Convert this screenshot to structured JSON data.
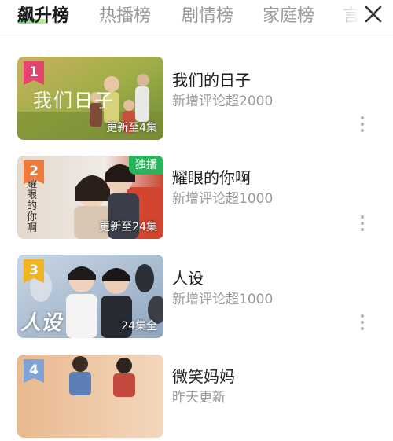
{
  "tabs": [
    {
      "label": "飙升榜",
      "active": true
    },
    {
      "label": "热播榜",
      "active": false
    },
    {
      "label": "剧情榜",
      "active": false
    },
    {
      "label": "家庭榜",
      "active": false
    },
    {
      "label": "言",
      "active": false
    }
  ],
  "close_icon": "close-icon",
  "colors": {
    "accent_green": "#29b35a",
    "rank_1": "#e8436f",
    "rank_2": "#f07a3a",
    "rank_3": "#f2b41f",
    "rank_4": "#7ea3d6",
    "subtitle_gray": "#9a9a9a"
  },
  "list": [
    {
      "rank": "1",
      "title": "我们的日子",
      "subtitle": "新增评论超2000",
      "episode": "更新至4集",
      "badge": "",
      "poster_text": "我们日子",
      "more_icon": "more-vertical-icon"
    },
    {
      "rank": "2",
      "title": "耀眼的你啊",
      "subtitle": "新增评论超1000",
      "episode": "更新至24集",
      "badge": "独播",
      "poster_text": "耀眼的你啊",
      "more_icon": "more-vertical-icon"
    },
    {
      "rank": "3",
      "title": "人设",
      "subtitle": "新增评论超1000",
      "episode": "24集全",
      "badge": "",
      "poster_text": "人设",
      "more_icon": "more-vertical-icon"
    },
    {
      "rank": "4",
      "title": "微笑妈妈",
      "subtitle": "昨天更新",
      "episode": "",
      "badge": "",
      "poster_text": "",
      "more_icon": "more-vertical-icon"
    }
  ]
}
